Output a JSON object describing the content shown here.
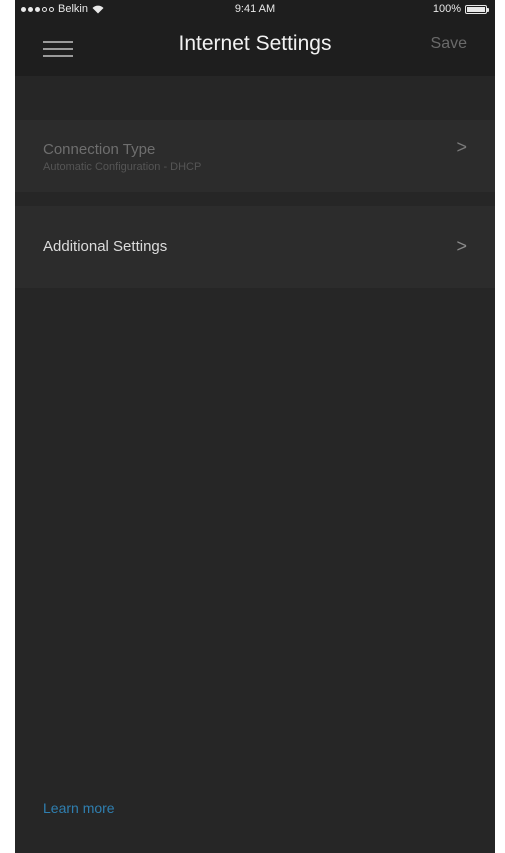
{
  "status_bar": {
    "carrier": "Belkin",
    "time": "9:41 AM",
    "battery_percent": "100%",
    "battery_level": 1.0,
    "wifi_icon": "wifi-icon",
    "battery_icon": "battery-icon"
  },
  "header": {
    "title": "Internet Settings",
    "save_label": "Save",
    "menu_icon": "hamburger-menu-icon"
  },
  "settings": {
    "connection_type": {
      "label": "Connection Type",
      "value": "Automatic Configuration - DHCP",
      "chevron": ">"
    },
    "additional_settings": {
      "label": "Additional Settings",
      "chevron": ">"
    }
  },
  "footer": {
    "learn_more": "Learn more"
  },
  "colors": {
    "background": "#262626",
    "header_background": "#1e1e1e",
    "row_background": "#2c2c2c",
    "link": "#2f7fb0"
  }
}
